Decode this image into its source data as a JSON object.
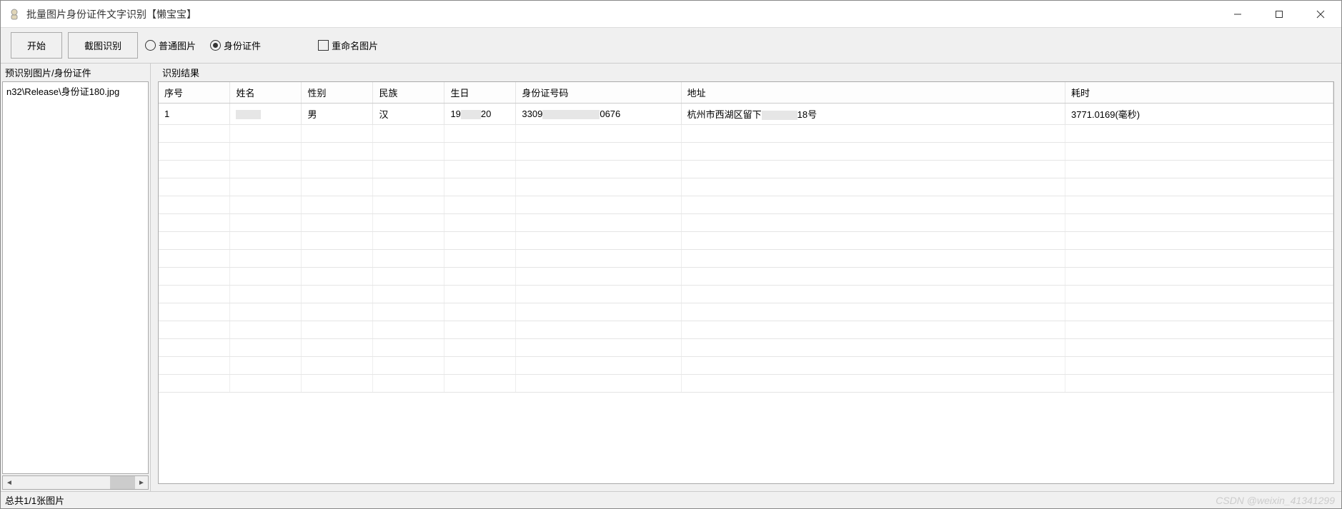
{
  "window": {
    "title": "批量图片身份证件文字识别【懒宝宝】"
  },
  "toolbar": {
    "start_label": "开始",
    "screenshot_label": "截图识别",
    "radio_normal": "普通图片",
    "radio_idcard": "身份证件",
    "checkbox_rename": "重命名图片",
    "radio_selected": "idcard"
  },
  "left": {
    "header": "预识别图片/身份证件",
    "items": [
      "n32\\Release\\身份证180.jpg"
    ]
  },
  "right": {
    "header": "识别结果",
    "columns": [
      "序号",
      "姓名",
      "性别",
      "民族",
      "生日",
      "身份证号码",
      "地址",
      "耗时"
    ],
    "rows": [
      {
        "index": "1",
        "name_prefix": "",
        "sex": "男",
        "ethnicity": "汉",
        "birthday_prefix": "19",
        "birthday_suffix": "20",
        "id_prefix": "3309",
        "id_suffix": "0676",
        "addr_prefix": "杭州市西湖区留下",
        "addr_suffix": "18号",
        "time": "3771.0169(毫秒)"
      }
    ]
  },
  "statusbar": {
    "text": "总共1/1张图片"
  },
  "watermark": "CSDN @weixin_41341299"
}
